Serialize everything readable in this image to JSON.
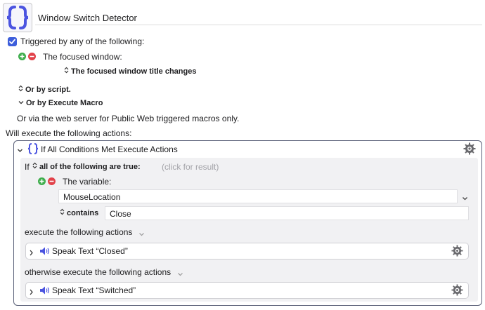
{
  "macro": {
    "name": "Window Switch Detector"
  },
  "trigger": {
    "checkbox_label": "Triggered by any of the following:",
    "focused_window_label": "The focused window:",
    "focused_window_condition": "The focused window title changes",
    "script_label": "Or by script.",
    "execute_macro_label": "Or by Execute Macro",
    "web_server_label": "Or via the web server for Public Web triggered macros only."
  },
  "actions_header": "Will execute the following actions:",
  "if_action": {
    "title": "If All Conditions Met Execute Actions",
    "if_label": "If",
    "condition_mode": "all of the following are true:",
    "click_hint": "(click for result)",
    "variable_label": "The variable:",
    "variable_value": "MouseLocation",
    "operator": "contains",
    "compare_value": "Close",
    "then_label": "execute the following actions",
    "then_action": "Speak Text “Closed”",
    "else_label": "otherwise execute the following actions",
    "else_action": "Speak Text “Switched”"
  },
  "colors": {
    "accent": "#3d5edb",
    "plus": "#3fae4d",
    "minus": "#e2424a",
    "border": "#5a6078"
  }
}
